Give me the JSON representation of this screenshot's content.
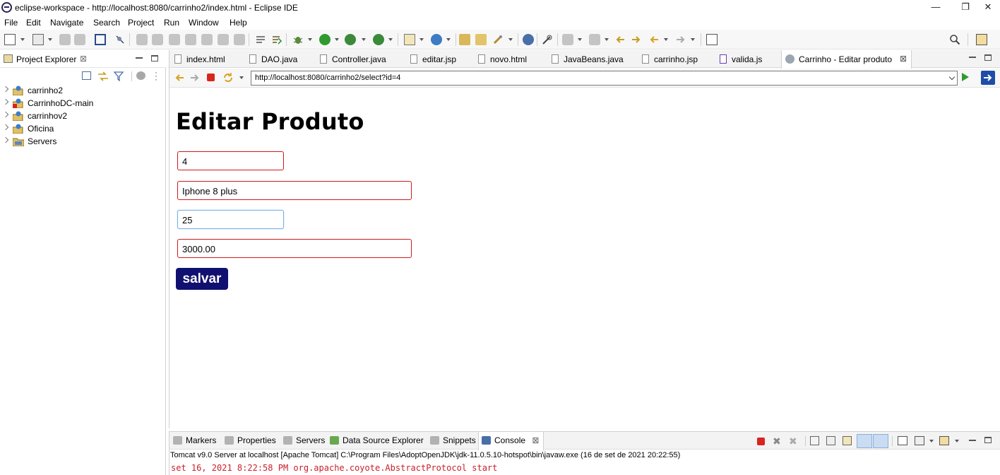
{
  "window": {
    "title": "eclipse-workspace - http://localhost:8080/carrinho2/index.html - Eclipse IDE",
    "minimize": "—",
    "restore": "❐",
    "close": "✕"
  },
  "menu": [
    "File",
    "Edit",
    "Navigate",
    "Search",
    "Project",
    "Run",
    "Window",
    "Help"
  ],
  "project_explorer": {
    "title": "Project Explorer",
    "close_glyph": "⊠",
    "items": [
      {
        "label": "carrinho2",
        "icon": "web-project-icon"
      },
      {
        "label": "CarrinhoDC-main",
        "icon": "error-project-icon"
      },
      {
        "label": "carrinhov2",
        "icon": "web-project-icon"
      },
      {
        "label": "Oficina",
        "icon": "web-project-icon"
      },
      {
        "label": "Servers",
        "icon": "folder-icon"
      }
    ]
  },
  "editor_tabs": [
    {
      "label": "index.html",
      "active": false
    },
    {
      "label": "DAO.java",
      "active": false
    },
    {
      "label": "Controller.java",
      "active": false
    },
    {
      "label": "editar.jsp",
      "active": false
    },
    {
      "label": "novo.html",
      "active": false
    },
    {
      "label": "JavaBeans.java",
      "active": false
    },
    {
      "label": "carrinho.jsp",
      "active": false
    },
    {
      "label": "valida.js",
      "active": false
    },
    {
      "label": "Carrinho - Editar produto",
      "active": true
    }
  ],
  "browser": {
    "url": "http://localhost:8080/carrinho2/select?id=4"
  },
  "page": {
    "heading": "Editar Produto",
    "fields": {
      "id": "4",
      "name": "Iphone 8 plus",
      "quantity": "25",
      "price": "3000.00"
    },
    "save_label": "salvar"
  },
  "bottom_tabs": [
    "Markers",
    "Properties",
    "Servers",
    "Data Source Explorer",
    "Snippets",
    "Console"
  ],
  "console": {
    "info": "Tomcat v9.0 Server at localhost [Apache Tomcat] C:\\Program Files\\AdoptOpenJDK\\jdk-11.0.5.10-hotspot\\bin\\javaw.exe  (16 de set de 2021 20:22:55)",
    "output": "set 16, 2021 8:22:58 PM org.apache.coyote.AbstractProtocol start"
  },
  "colors": {
    "save_button": "#101070",
    "invalid_border": "#cc1b1b",
    "valid_border": "#78b2e6",
    "console_error": "#c8202a"
  }
}
